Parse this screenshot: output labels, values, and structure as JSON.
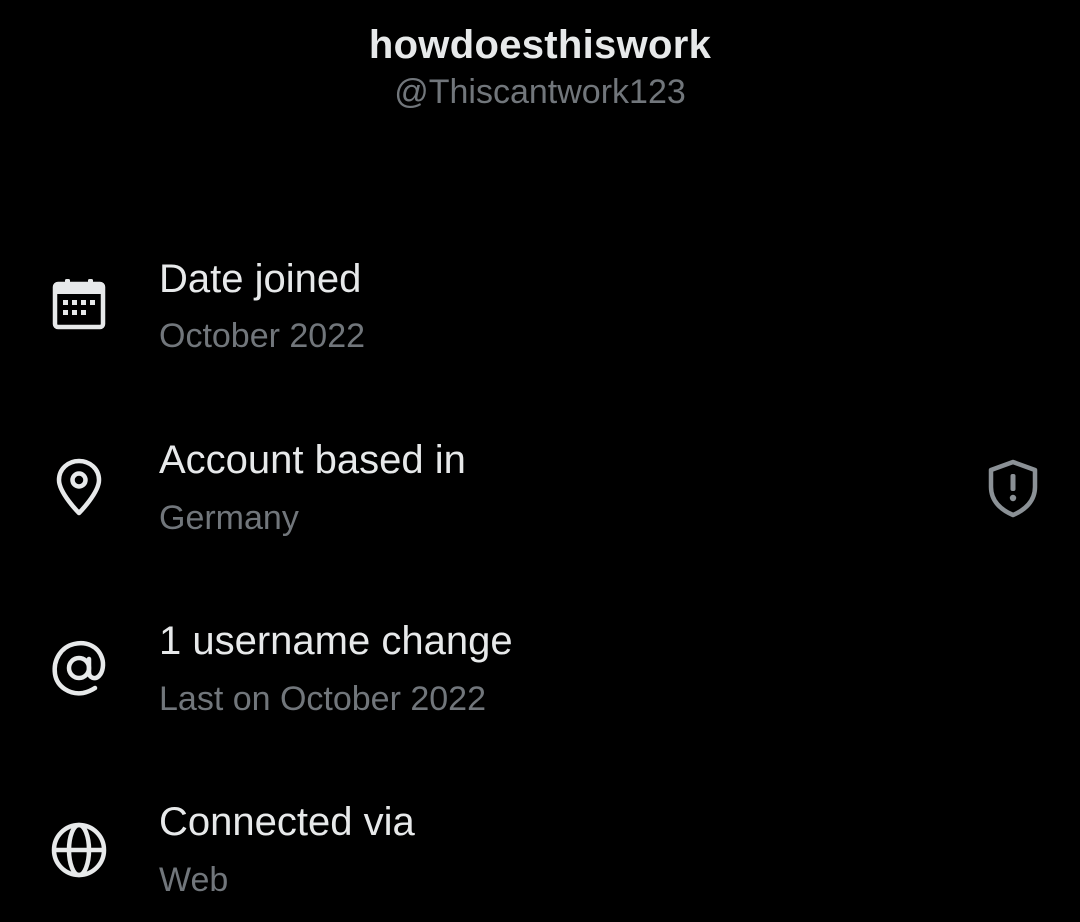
{
  "profile": {
    "display_name": "howdoesthiswork",
    "handle": "@Thiscantwork123"
  },
  "rows": [
    {
      "icon": "calendar-icon",
      "title": "Date joined",
      "subtitle": "October 2022"
    },
    {
      "icon": "location-pin-icon",
      "title": "Account based in",
      "subtitle": "Germany",
      "trailing_icon": "shield-alert-icon"
    },
    {
      "icon": "at-sign-icon",
      "title": "1 username change",
      "subtitle": "Last on October 2022"
    },
    {
      "icon": "globe-icon",
      "title": "Connected via",
      "subtitle": "Web"
    }
  ],
  "colors": {
    "background": "#000000",
    "primary_text": "#e7e9ea",
    "secondary_text": "#71767b",
    "icon": "#e7e9ea",
    "trailing_icon": "#8b9196"
  }
}
